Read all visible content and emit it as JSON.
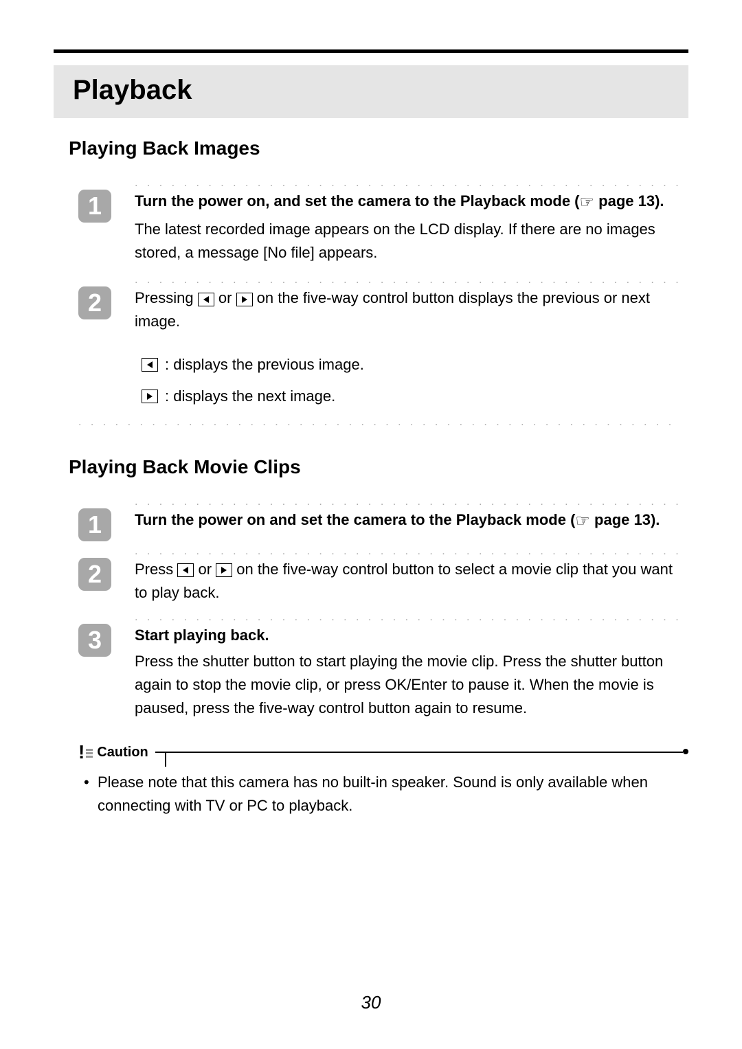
{
  "chapter_title": "Playback",
  "page_number": "30",
  "section1": {
    "heading": "Playing Back Images",
    "steps": [
      {
        "num": "1",
        "bold_lead": "Turn the power on, and set the camera to the Playback mode (",
        "bold_tail": "  page 13).",
        "body": "The latest recorded image appears on the LCD display. If there are no images stored, a message [No file] appears."
      },
      {
        "num": "2",
        "lead": "Pressing ",
        "mid": " or ",
        "tail": " on the five-way control button displays the previous or next image.",
        "sub_prev": ": displays the previous image.",
        "sub_next": ": displays the next image."
      }
    ]
  },
  "section2": {
    "heading": "Playing Back Movie Clips",
    "steps": [
      {
        "num": "1",
        "bold_lead": "Turn the power on and set the camera to the Playback mode (",
        "bold_tail": "  page 13)."
      },
      {
        "num": "2",
        "lead": "Press ",
        "mid": " or ",
        "tail": " on the five-way control button to select a movie clip that you want to play back."
      },
      {
        "num": "3",
        "bold_lead": "Start playing back.",
        "body": "Press the shutter button to start playing the movie clip. Press the shutter button again to stop the movie clip, or press OK/Enter to pause it. When the movie is paused, press the five-way control button again to resume."
      }
    ]
  },
  "caution": {
    "label": "Caution",
    "text": "Please note that this camera has no built-in speaker. Sound is only available when connecting with TV or PC to playback."
  }
}
